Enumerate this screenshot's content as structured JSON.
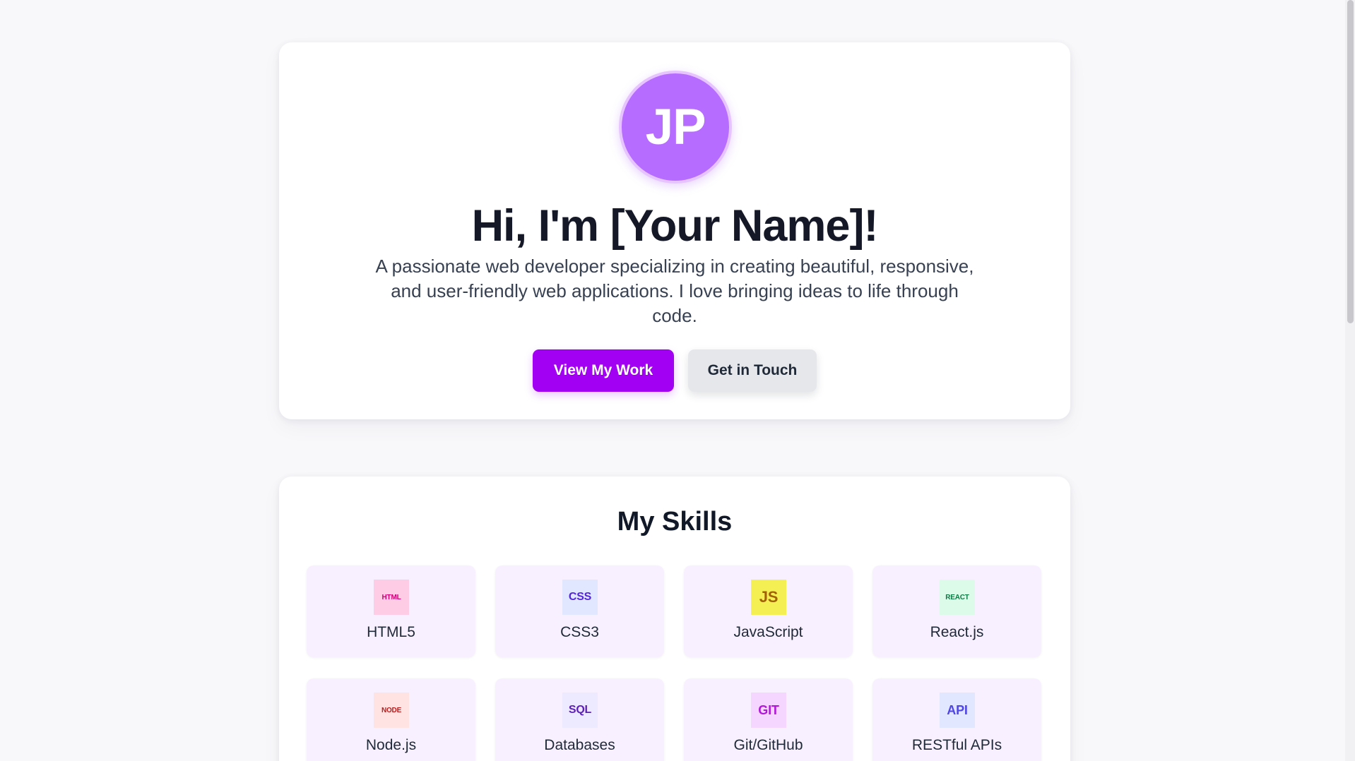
{
  "profile": {
    "initials": "JP",
    "greeting": "Hi, I'm [Your Name]!",
    "description": "A passionate web developer specializing in creating beautiful, responsive, and user-friendly web applications. I love bringing ideas to life through code.",
    "actions": {
      "primary_label": "View My Work",
      "secondary_label": "Get in Touch"
    }
  },
  "skills": {
    "title": "My Skills",
    "items": [
      {
        "icon_text": "HTML",
        "label": "HTML5",
        "icon": "html-icon"
      },
      {
        "icon_text": "CSS",
        "label": "CSS3",
        "icon": "css-icon"
      },
      {
        "icon_text": "JS",
        "label": "JavaScript",
        "icon": "javascript-icon"
      },
      {
        "icon_text": "REACT",
        "label": "React.js",
        "icon": "react-icon"
      },
      {
        "icon_text": "NODE",
        "label": "Node.js",
        "icon": "node-icon"
      },
      {
        "icon_text": "SQL",
        "label": "Databases",
        "icon": "sql-icon"
      },
      {
        "icon_text": "GIT",
        "label": "Git/GitHub",
        "icon": "git-icon"
      },
      {
        "icon_text": "API",
        "label": "RESTful APIs",
        "icon": "api-icon"
      }
    ]
  },
  "colors": {
    "accent": "#a100f2",
    "avatar": "#b56cff",
    "background": "#f8f8fb",
    "skill_tile": "#f8f0ff"
  }
}
